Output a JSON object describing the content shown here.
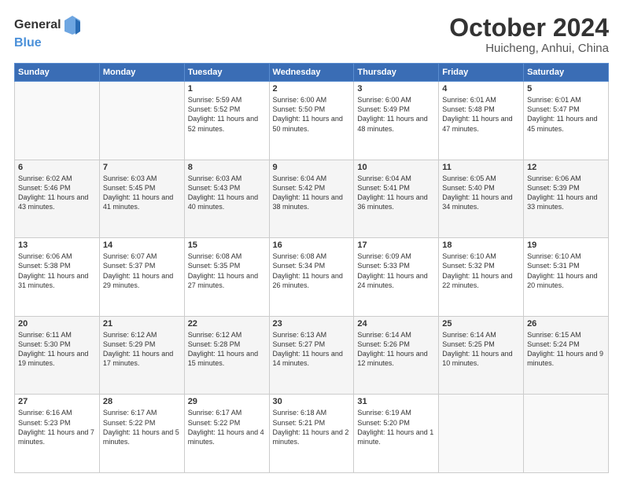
{
  "header": {
    "logo_general": "General",
    "logo_blue": "Blue",
    "month": "October 2024",
    "location": "Huicheng, Anhui, China"
  },
  "days_of_week": [
    "Sunday",
    "Monday",
    "Tuesday",
    "Wednesday",
    "Thursday",
    "Friday",
    "Saturday"
  ],
  "weeks": [
    [
      {
        "day": "",
        "info": ""
      },
      {
        "day": "",
        "info": ""
      },
      {
        "day": "1",
        "info": "Sunrise: 5:59 AM\nSunset: 5:52 PM\nDaylight: 11 hours and 52 minutes."
      },
      {
        "day": "2",
        "info": "Sunrise: 6:00 AM\nSunset: 5:50 PM\nDaylight: 11 hours and 50 minutes."
      },
      {
        "day": "3",
        "info": "Sunrise: 6:00 AM\nSunset: 5:49 PM\nDaylight: 11 hours and 48 minutes."
      },
      {
        "day": "4",
        "info": "Sunrise: 6:01 AM\nSunset: 5:48 PM\nDaylight: 11 hours and 47 minutes."
      },
      {
        "day": "5",
        "info": "Sunrise: 6:01 AM\nSunset: 5:47 PM\nDaylight: 11 hours and 45 minutes."
      }
    ],
    [
      {
        "day": "6",
        "info": "Sunrise: 6:02 AM\nSunset: 5:46 PM\nDaylight: 11 hours and 43 minutes."
      },
      {
        "day": "7",
        "info": "Sunrise: 6:03 AM\nSunset: 5:45 PM\nDaylight: 11 hours and 41 minutes."
      },
      {
        "day": "8",
        "info": "Sunrise: 6:03 AM\nSunset: 5:43 PM\nDaylight: 11 hours and 40 minutes."
      },
      {
        "day": "9",
        "info": "Sunrise: 6:04 AM\nSunset: 5:42 PM\nDaylight: 11 hours and 38 minutes."
      },
      {
        "day": "10",
        "info": "Sunrise: 6:04 AM\nSunset: 5:41 PM\nDaylight: 11 hours and 36 minutes."
      },
      {
        "day": "11",
        "info": "Sunrise: 6:05 AM\nSunset: 5:40 PM\nDaylight: 11 hours and 34 minutes."
      },
      {
        "day": "12",
        "info": "Sunrise: 6:06 AM\nSunset: 5:39 PM\nDaylight: 11 hours and 33 minutes."
      }
    ],
    [
      {
        "day": "13",
        "info": "Sunrise: 6:06 AM\nSunset: 5:38 PM\nDaylight: 11 hours and 31 minutes."
      },
      {
        "day": "14",
        "info": "Sunrise: 6:07 AM\nSunset: 5:37 PM\nDaylight: 11 hours and 29 minutes."
      },
      {
        "day": "15",
        "info": "Sunrise: 6:08 AM\nSunset: 5:35 PM\nDaylight: 11 hours and 27 minutes."
      },
      {
        "day": "16",
        "info": "Sunrise: 6:08 AM\nSunset: 5:34 PM\nDaylight: 11 hours and 26 minutes."
      },
      {
        "day": "17",
        "info": "Sunrise: 6:09 AM\nSunset: 5:33 PM\nDaylight: 11 hours and 24 minutes."
      },
      {
        "day": "18",
        "info": "Sunrise: 6:10 AM\nSunset: 5:32 PM\nDaylight: 11 hours and 22 minutes."
      },
      {
        "day": "19",
        "info": "Sunrise: 6:10 AM\nSunset: 5:31 PM\nDaylight: 11 hours and 20 minutes."
      }
    ],
    [
      {
        "day": "20",
        "info": "Sunrise: 6:11 AM\nSunset: 5:30 PM\nDaylight: 11 hours and 19 minutes."
      },
      {
        "day": "21",
        "info": "Sunrise: 6:12 AM\nSunset: 5:29 PM\nDaylight: 11 hours and 17 minutes."
      },
      {
        "day": "22",
        "info": "Sunrise: 6:12 AM\nSunset: 5:28 PM\nDaylight: 11 hours and 15 minutes."
      },
      {
        "day": "23",
        "info": "Sunrise: 6:13 AM\nSunset: 5:27 PM\nDaylight: 11 hours and 14 minutes."
      },
      {
        "day": "24",
        "info": "Sunrise: 6:14 AM\nSunset: 5:26 PM\nDaylight: 11 hours and 12 minutes."
      },
      {
        "day": "25",
        "info": "Sunrise: 6:14 AM\nSunset: 5:25 PM\nDaylight: 11 hours and 10 minutes."
      },
      {
        "day": "26",
        "info": "Sunrise: 6:15 AM\nSunset: 5:24 PM\nDaylight: 11 hours and 9 minutes."
      }
    ],
    [
      {
        "day": "27",
        "info": "Sunrise: 6:16 AM\nSunset: 5:23 PM\nDaylight: 11 hours and 7 minutes."
      },
      {
        "day": "28",
        "info": "Sunrise: 6:17 AM\nSunset: 5:22 PM\nDaylight: 11 hours and 5 minutes."
      },
      {
        "day": "29",
        "info": "Sunrise: 6:17 AM\nSunset: 5:22 PM\nDaylight: 11 hours and 4 minutes."
      },
      {
        "day": "30",
        "info": "Sunrise: 6:18 AM\nSunset: 5:21 PM\nDaylight: 11 hours and 2 minutes."
      },
      {
        "day": "31",
        "info": "Sunrise: 6:19 AM\nSunset: 5:20 PM\nDaylight: 11 hours and 1 minute."
      },
      {
        "day": "",
        "info": ""
      },
      {
        "day": "",
        "info": ""
      }
    ]
  ]
}
